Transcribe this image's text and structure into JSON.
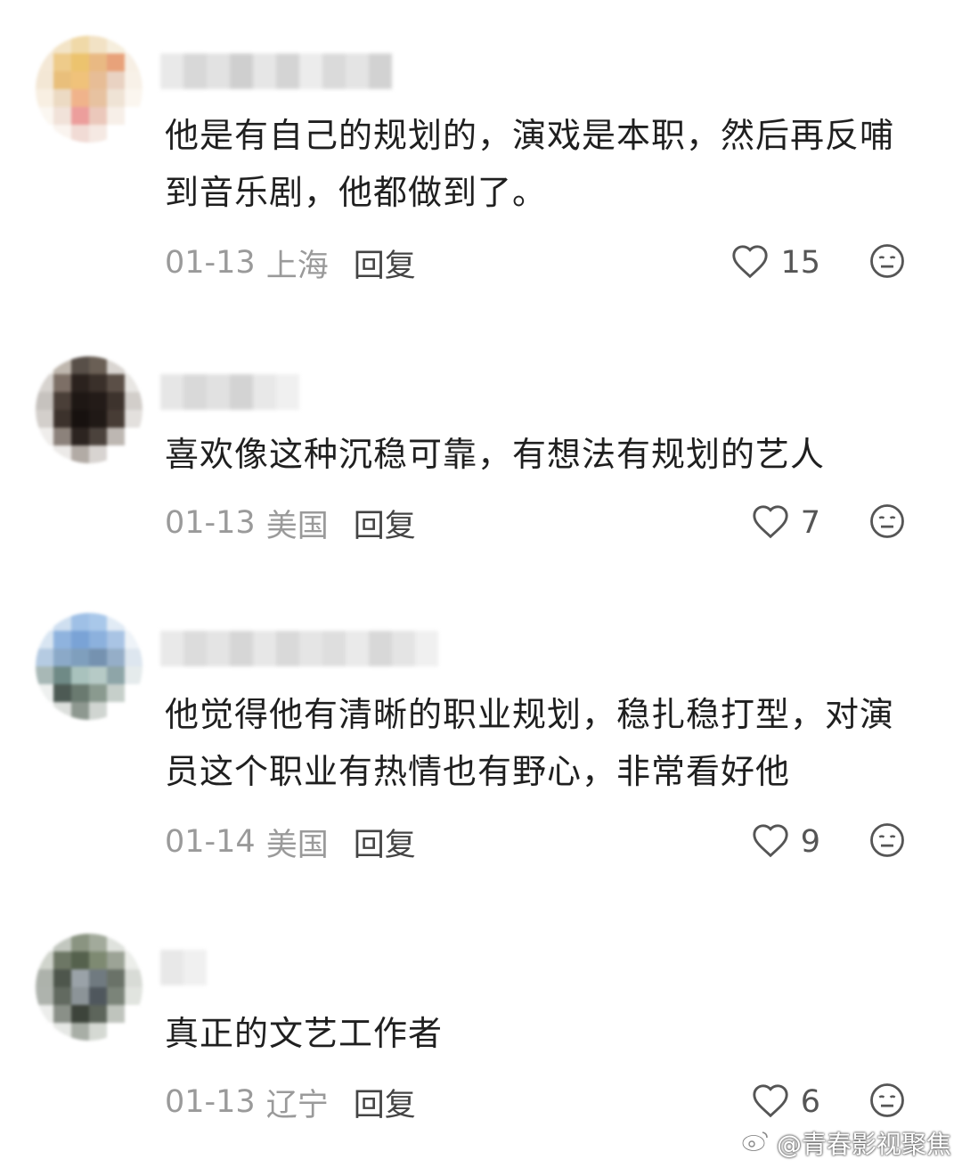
{
  "comments": [
    {
      "text": "他是有自己的规划的，演戏是本职，然后再反哺到音乐剧，他都做到了。",
      "date": "01-13",
      "location": "上海",
      "reply_label": "回复",
      "likes": "15"
    },
    {
      "text": "喜欢像这种沉稳可靠，有想法有规划的艺人",
      "date": "01-13",
      "location": "美国",
      "reply_label": "回复",
      "likes": "7"
    },
    {
      "text": "他觉得他有清晰的职业规划，稳扎稳打型，对演员这个职业有热情也有野心，非常看好他",
      "date": "01-14",
      "location": "美国",
      "reply_label": "回复",
      "likes": "9"
    },
    {
      "text": "真正的文艺工作者",
      "date": "01-13",
      "location": "辽宁",
      "reply_label": "回复",
      "likes": "6"
    }
  ],
  "icons": {
    "like": "heart-outline-icon",
    "dislike": "neutral-face-icon",
    "watermark": "weibo-logo-icon"
  },
  "watermark": {
    "text": "@青春影视聚焦"
  },
  "colors": {
    "text": "#1f1f1f",
    "meta": "#9a9a9a",
    "reply": "#444444",
    "icon": "#666666"
  }
}
